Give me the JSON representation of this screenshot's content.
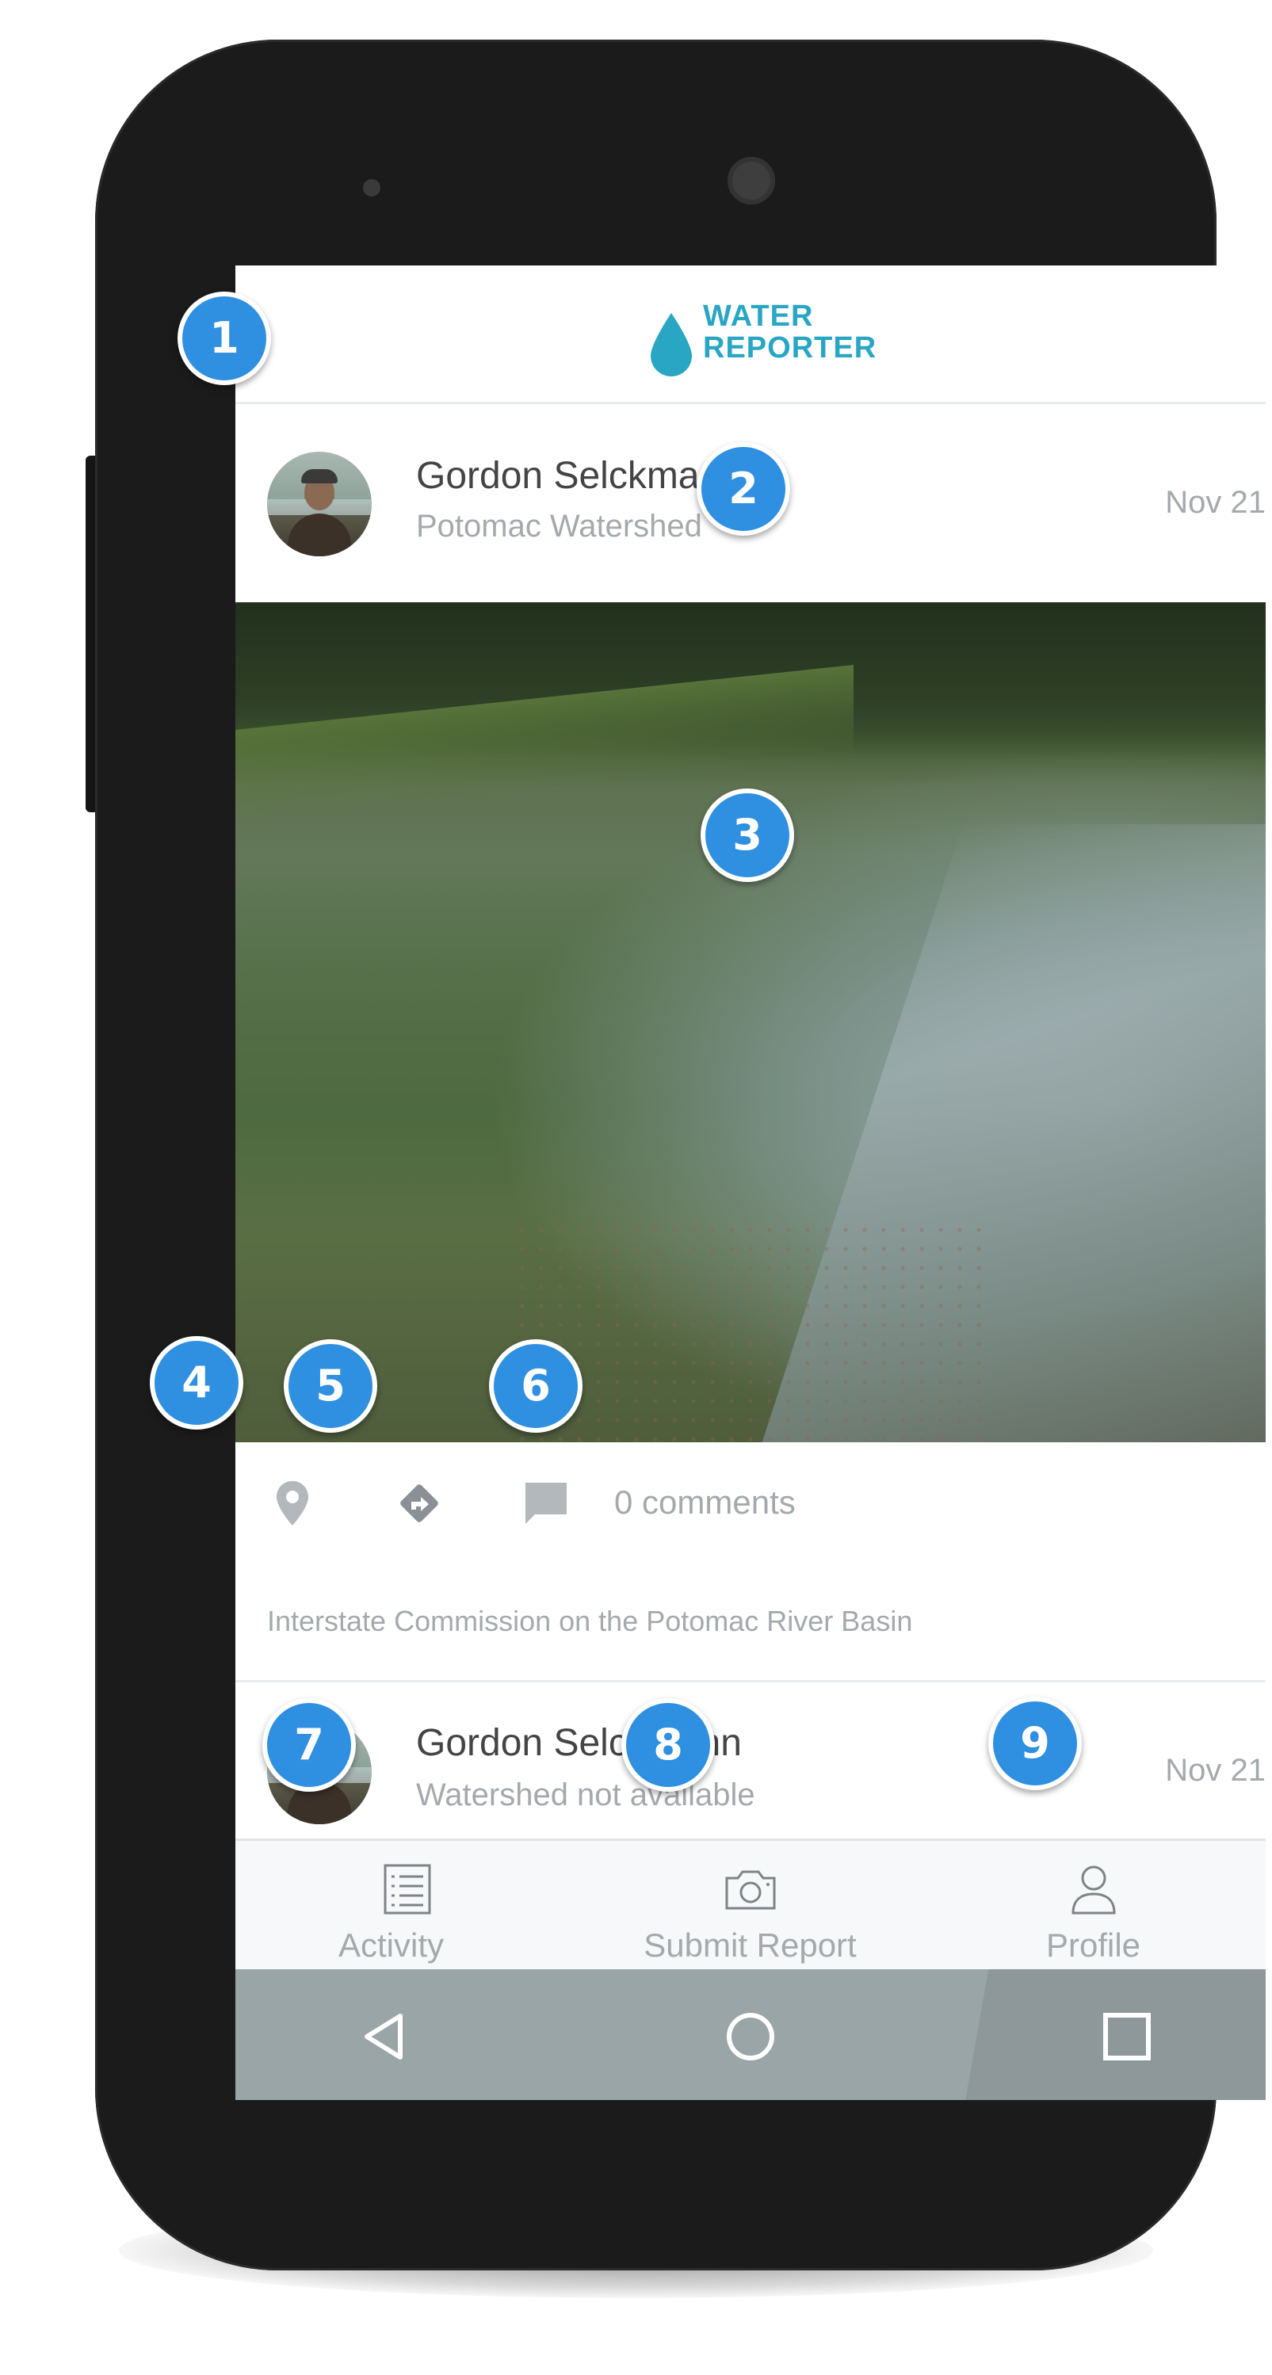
{
  "app": {
    "logo_line1": "WATER",
    "logo_line2": "REPORTER",
    "brand_color": "#29a6c3",
    "callout_color": "#2f8fe0"
  },
  "posts": [
    {
      "user_name": "Gordon Selckmann",
      "watershed": "Potomac Watershed",
      "date": "Nov 21",
      "comments_label": "0 comments",
      "organization": "Interstate Commission on the Potomac River Basin"
    },
    {
      "user_name": "Gordon Selckmann",
      "watershed": "Watershed not available",
      "date": "Nov 21"
    }
  ],
  "tabs": [
    {
      "label": "Activity",
      "icon": "list-icon"
    },
    {
      "label": "Submit Report",
      "icon": "camera-icon"
    },
    {
      "label": "Profile",
      "icon": "person-icon"
    }
  ],
  "nav": {
    "back_icon": "triangle-back-icon",
    "home_icon": "circle-home-icon",
    "recents_icon": "square-recents-icon"
  },
  "callouts": [
    "1",
    "2",
    "3",
    "4",
    "5",
    "6",
    "7",
    "8",
    "9"
  ]
}
